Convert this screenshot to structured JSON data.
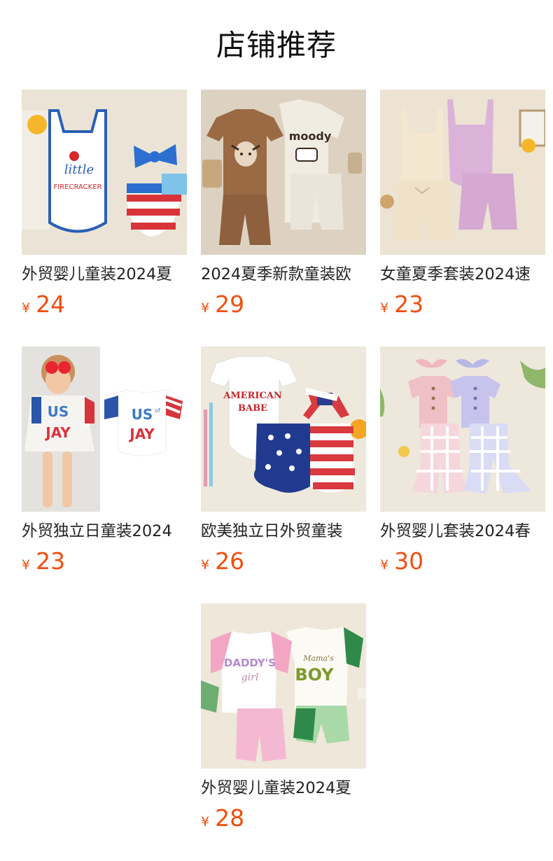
{
  "section": {
    "title": "店铺推荐"
  },
  "products": [
    {
      "name": "外贸婴儿童装2024夏",
      "currency": "¥",
      "price": "24"
    },
    {
      "name": "2024夏季新款童装欧",
      "currency": "¥",
      "price": "29"
    },
    {
      "name": "女童夏季套装2024速",
      "currency": "¥",
      "price": "23"
    },
    {
      "name": "外贸独立日童装2024",
      "currency": "¥",
      "price": "23"
    },
    {
      "name": "欧美独立日外贸童装",
      "currency": "¥",
      "price": "26"
    },
    {
      "name": "外贸婴儿套装2024春",
      "currency": "¥",
      "price": "30"
    },
    {
      "name": "外贸婴儿童装2024夏",
      "currency": "¥",
      "price": "28"
    }
  ],
  "image_text": {
    "p1_top": "little",
    "p1_bottom": "FIRECRACKER",
    "p2_shirt": "moody",
    "p4_a": "US",
    "p4_b": "of",
    "p4_c": "JAY",
    "p5_a": "AMERICAN",
    "p5_b": "BABE",
    "p7_a": "DADDY'S",
    "p7_b": "girl",
    "p7_c": "Mama's",
    "p7_d": "BOY"
  },
  "colors": {
    "price": "#f04e0f",
    "title": "#111111"
  }
}
